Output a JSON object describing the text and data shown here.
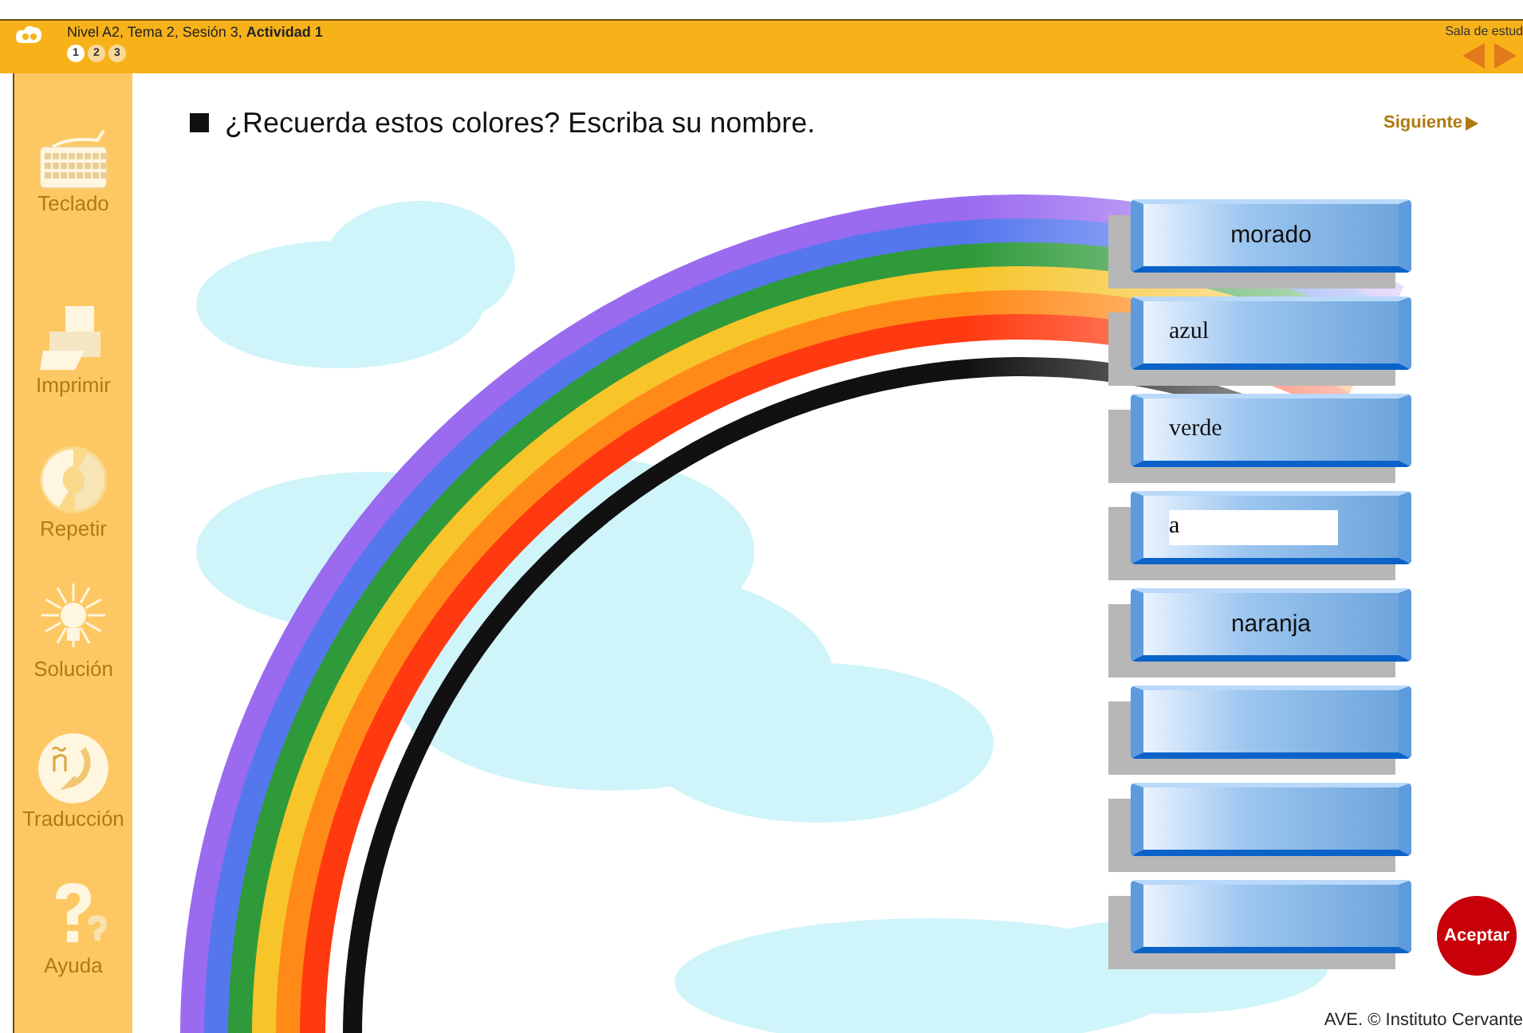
{
  "header": {
    "breadcrumb": "Nivel A2, Tema 2, Sesión 3, **Actividad 1**",
    "steps": [
      {
        "label": "1",
        "selected": true
      },
      {
        "label": "2",
        "selected": false
      },
      {
        "label": "3",
        "selected": false
      }
    ],
    "room": "Sala de estud"
  },
  "sidebar": {
    "tools": [
      {
        "kind": "keyboard",
        "label": "Teclado"
      },
      {
        "kind": "printer",
        "label": "Imprimir"
      },
      {
        "kind": "repeat",
        "label": "Repetir"
      },
      {
        "kind": "solution",
        "label": "Solución"
      },
      {
        "kind": "translation",
        "label": "Traducción"
      },
      {
        "kind": "help",
        "label": "Ayuda"
      }
    ]
  },
  "instruction": "¿Recuerda estos colores? Escriba su nombre.",
  "next_link": "Siguiente",
  "tiles": [
    {
      "kind": "word",
      "text": "morado"
    },
    {
      "kind": "answer",
      "text": "azul"
    },
    {
      "kind": "answer",
      "text": "verde"
    },
    {
      "kind": "input",
      "text": "a"
    },
    {
      "kind": "word",
      "text": "naranja"
    },
    {
      "kind": "blank"
    },
    {
      "kind": "blank"
    },
    {
      "kind": "blank"
    }
  ],
  "accept_button": "Aceptar",
  "footer": "AVE. © Instituto Cervante"
}
